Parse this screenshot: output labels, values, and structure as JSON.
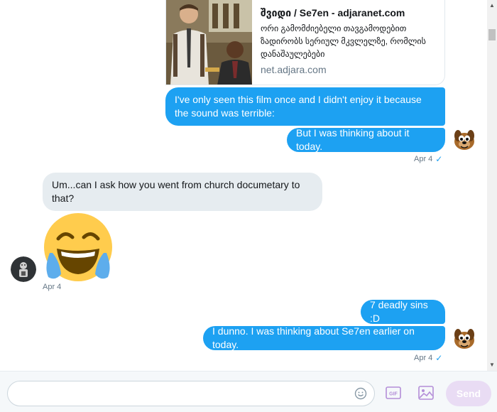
{
  "link_card": {
    "title": "შვიდი / Se7en - adjaranet.com",
    "description": "ორი გამომძიებელი თავგამოდებით ზადირობს სერიულ მკვლელზე, რომლის დანაშაულებები",
    "domain": "net.adjara.com"
  },
  "messages": [
    {
      "direction": "out",
      "text": "I've only seen this film once and I didn't enjoy it because the sound was terrible:"
    },
    {
      "direction": "out",
      "text": "But I was thinking about it today.",
      "time": "Apr 4",
      "read": "✓"
    },
    {
      "direction": "in",
      "text": "Um...can I ask how you went from church documetary to that?"
    },
    {
      "direction": "in",
      "emoji": "face-with-tears-of-joy",
      "time": "Apr 4"
    },
    {
      "direction": "out",
      "text": "7 deadly sins :D"
    },
    {
      "direction": "out",
      "text": "I dunno. I was thinking about Se7en earlier on today.",
      "time": "Apr 4",
      "read": "✓"
    }
  ],
  "composer": {
    "placeholder": "",
    "gif_label": "GIF",
    "send_label": "Send"
  },
  "colors": {
    "outgoing_bubble": "#1da1f2",
    "incoming_bubble": "#e6ecf0",
    "send_disabled": "#e9dcf4"
  },
  "icons": {
    "emoji_picker": "smiley-icon",
    "gif": "gif-icon",
    "media": "image-icon",
    "scroll_up": "arrow-up-icon",
    "scroll_down": "arrow-down-icon"
  }
}
